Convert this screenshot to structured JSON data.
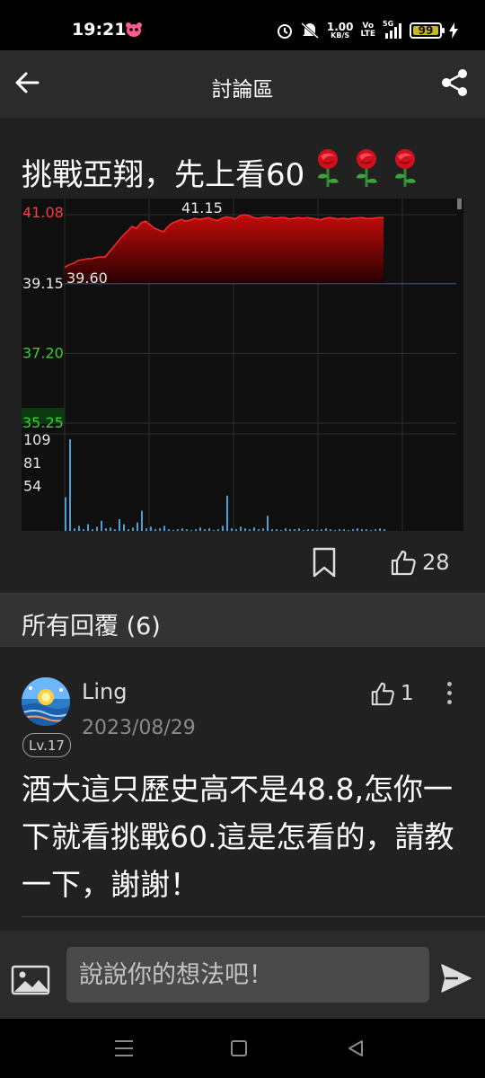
{
  "status_bar": {
    "time": "19:21",
    "net_rate": "1.00",
    "net_unit": "KB/S",
    "volte_top": "Vo",
    "volte_bottom": "LTE",
    "signal": "5G",
    "battery": 99,
    "battery_color": "#c9b825"
  },
  "app_bar": {
    "title": "討論區",
    "back_icon": "arrow-left-icon",
    "share_icon": "share-icon"
  },
  "post": {
    "title": "挑戰亞翔，先上看60",
    "emoji": "rose",
    "emoji_count": 3,
    "like_count": "28"
  },
  "chart_data": {
    "type": "area",
    "title": "",
    "price_labels": [
      "41.08",
      "39.15",
      "37.20",
      "35.25"
    ],
    "price_label_colors": [
      "#ff3b3b",
      "#e6e6e6",
      "#35d435",
      "#35d435"
    ],
    "ylim": [
      35.25,
      41.08
    ],
    "reference": 39.15,
    "high_label": "41.15",
    "low_label": "39.60",
    "volume_labels": [
      "109",
      "81",
      "54"
    ],
    "volume_ylim": [
      0,
      109
    ],
    "prices": [
      39.6,
      39.68,
      39.72,
      39.8,
      39.82,
      39.85,
      39.85,
      39.88,
      39.9,
      39.9,
      40.05,
      40.2,
      40.35,
      40.5,
      40.62,
      40.75,
      40.7,
      40.85,
      40.9,
      40.8,
      40.7,
      40.65,
      40.6,
      40.75,
      40.85,
      40.9,
      40.95,
      40.9,
      40.93,
      40.98,
      40.95,
      40.97,
      41.0,
      40.95,
      40.92,
      40.98,
      41.02,
      41.0,
      40.96,
      41.05,
      41.08,
      41.06,
      41.0,
      40.98,
      41.0,
      41.02,
      41.0,
      40.98,
      41.0,
      41.0,
      40.96,
      40.98,
      41.0,
      40.98,
      41.0,
      40.98,
      40.96,
      40.94,
      40.98,
      41.0,
      40.98,
      40.96,
      40.98,
      40.96,
      40.98,
      40.99,
      41.0,
      40.98,
      40.97,
      40.99,
      41.0,
      41.0
    ],
    "volumes": [
      40,
      109,
      3,
      6,
      2,
      8,
      2,
      5,
      12,
      3,
      4,
      2,
      14,
      8,
      2,
      4,
      10,
      24,
      3,
      5,
      2,
      3,
      6,
      2,
      1,
      2,
      3,
      2,
      1,
      2,
      4,
      2,
      3,
      1,
      2,
      6,
      42,
      3,
      2,
      5,
      3,
      2,
      4,
      2,
      3,
      18,
      2,
      2,
      1,
      3,
      2,
      2,
      3,
      1,
      2,
      2,
      1,
      2,
      3,
      2,
      1,
      2,
      2,
      1,
      2,
      3,
      2,
      2,
      1,
      2,
      3,
      2
    ],
    "colors": {
      "area": "#c40c0c",
      "area_bottom": "#260000",
      "line": "#ff2a2a",
      "grid": "#2e2e2e",
      "volume": "#4a9fd4"
    }
  },
  "replies": {
    "title": "所有回覆 (6)"
  },
  "comment": {
    "author": "Ling",
    "date": "2023/08/29",
    "level": "Lv.17",
    "like_count": "1",
    "text": "酒大這只歷史高不是48.8,怎你一下就看挑戰60.這是怎看的，請教一下，謝謝！"
  },
  "input": {
    "placeholder": "說說你的想法吧！"
  }
}
